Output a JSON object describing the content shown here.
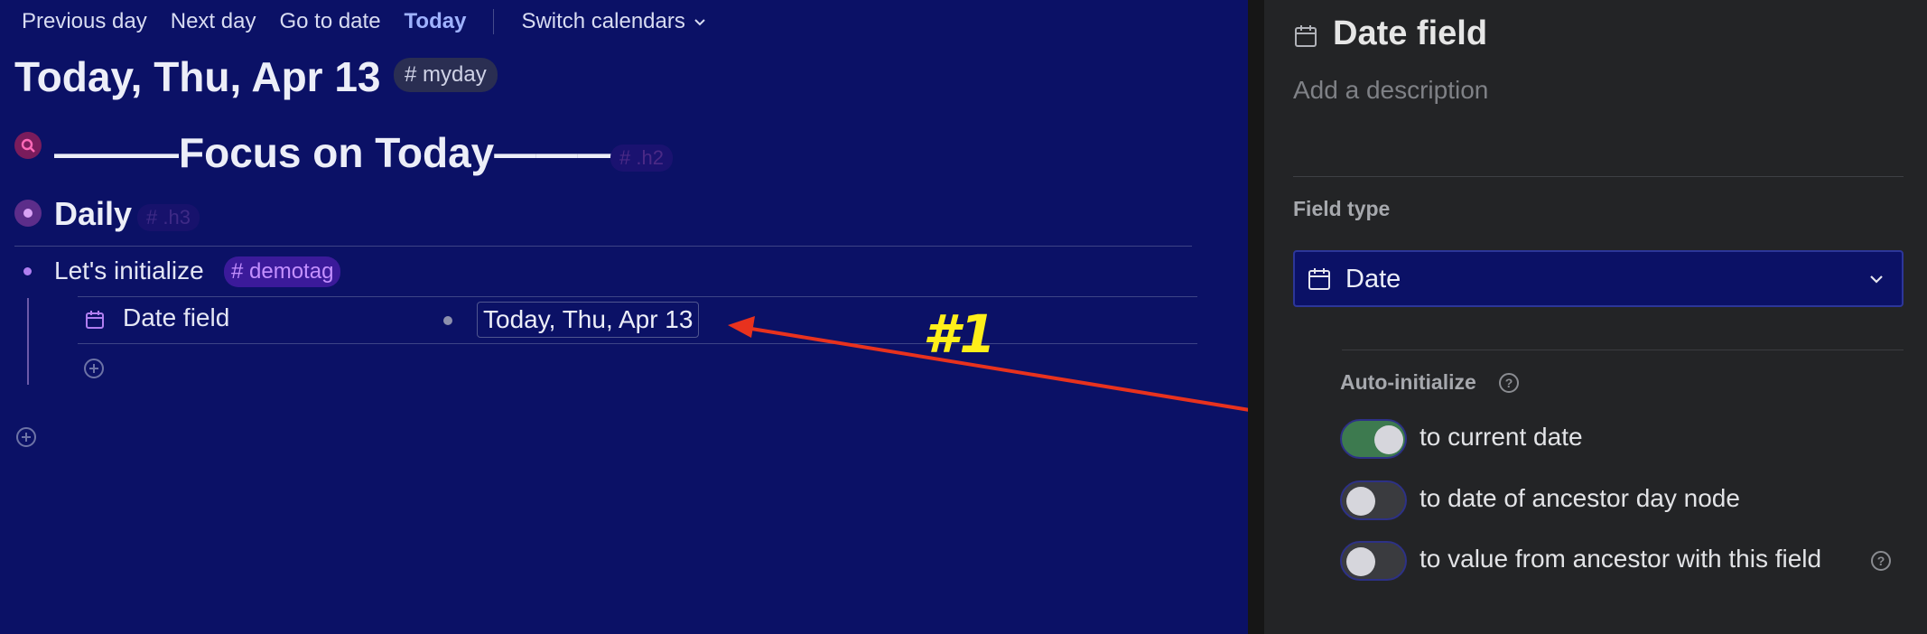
{
  "nav": {
    "previous_day": "Previous day",
    "next_day": "Next day",
    "go_to_date": "Go to date",
    "today": "Today",
    "switch_calendars": "Switch calendars"
  },
  "page": {
    "title": "Today, Thu, Apr 13",
    "tag": "# myday"
  },
  "outline": {
    "focus_heading": "———Focus on Today———",
    "focus_tag": "# .h2",
    "daily_heading": "Daily",
    "daily_tag": "# .h3",
    "init_text": "Let's initialize",
    "init_tag": "# demotag",
    "field_name": "Date field",
    "field_value": "Today, Thu, Apr 13"
  },
  "annotation": {
    "label": "#1",
    "color": "#ffef1a",
    "arrow_color": "#e8321e"
  },
  "panel": {
    "title": "Date field",
    "description_placeholder": "Add a description",
    "field_type_label": "Field type",
    "field_type_value": "Date",
    "auto_init_label": "Auto-initialize",
    "options": [
      {
        "label": "to current date",
        "enabled": true
      },
      {
        "label": "to date of ancestor day node",
        "enabled": false
      },
      {
        "label": "to value from ancestor with this field",
        "enabled": false
      }
    ]
  },
  "colors": {
    "left_bg": "#0b1166",
    "right_bg": "#232426",
    "accent_today": "#9fb2ff",
    "toggle_on": "#3d7a4f"
  }
}
